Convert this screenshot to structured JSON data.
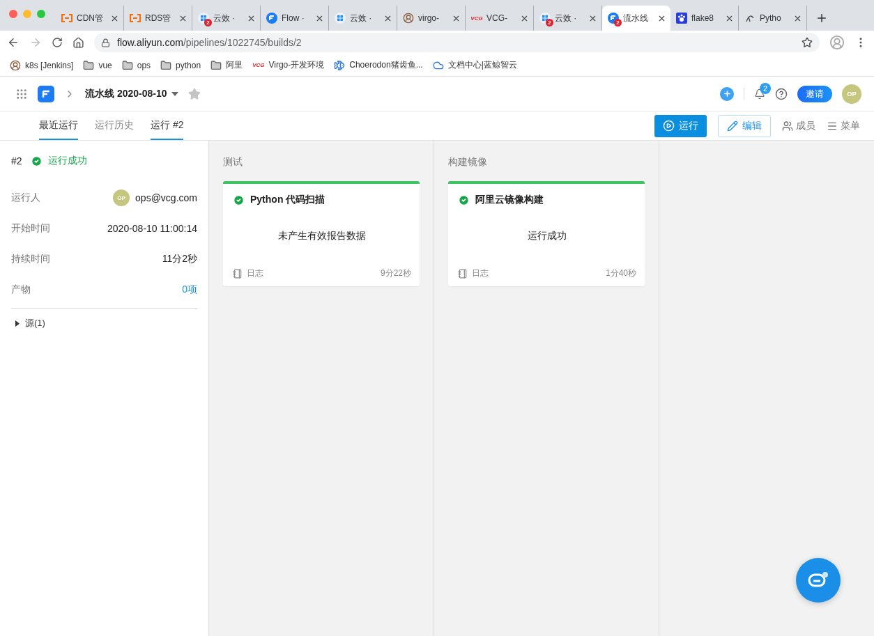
{
  "browser": {
    "tabs": [
      {
        "title": "CDN管",
        "kind": "bracket",
        "selected": false
      },
      {
        "title": "RDS管",
        "kind": "bracket",
        "selected": false
      },
      {
        "title": "云效 ·",
        "kind": "grid",
        "badge": "2",
        "selected": false
      },
      {
        "title": "Flow ·",
        "kind": "flow",
        "selected": false
      },
      {
        "title": "云效 ·",
        "kind": "grid",
        "selected": false
      },
      {
        "title": "virgo-",
        "kind": "person",
        "selected": false
      },
      {
        "title": "VCG-",
        "kind": "wordmark",
        "logo_text": "VCG",
        "selected": false
      },
      {
        "title": "云效 ·",
        "kind": "grid",
        "badge": "2",
        "selected": false
      },
      {
        "title": "流水线",
        "kind": "flow",
        "badge": "2",
        "selected": true
      },
      {
        "title": "flake8",
        "kind": "paw",
        "selected": false
      },
      {
        "title": "Pytho",
        "kind": "sketch",
        "selected": false
      }
    ],
    "address": {
      "host": "flow.aliyun.com",
      "path": "/pipelines/1022745/builds/2"
    },
    "bookmarks": [
      {
        "label": "k8s [Jenkins]",
        "kind": "person"
      },
      {
        "label": "vue",
        "kind": "folder"
      },
      {
        "label": "ops",
        "kind": "folder"
      },
      {
        "label": "python",
        "kind": "folder"
      },
      {
        "label": "阿里",
        "kind": "folder"
      },
      {
        "label": "Virgo-开发环境",
        "kind": "wordmark",
        "logo_text": "VCG"
      },
      {
        "label": "Choerodon猪齿鱼...",
        "kind": "fish"
      },
      {
        "label": "文档中心|蓝鲸智云",
        "kind": "cloud"
      }
    ]
  },
  "header": {
    "title": "流水线 2020-08-10",
    "starred": false,
    "notification_count": "2",
    "invite_button": "邀请",
    "avatar": "OP"
  },
  "nav": {
    "tabs": [
      {
        "label": "最近运行",
        "selected": true
      },
      {
        "label": "运行历史",
        "selected": false
      },
      {
        "label": "运行 #2",
        "selected": true
      }
    ],
    "run_button": "运行",
    "edit_button": "编辑",
    "members": "成员",
    "menu": "菜单"
  },
  "summary": {
    "number": "#2",
    "passed": true,
    "status_label": "运行成功",
    "fields": [
      {
        "label": "运行人",
        "value": "ops@vcg.com",
        "avatar": "OP",
        "kind": "user"
      },
      {
        "label": "开始时间",
        "value": "2020-08-10 11:00:14",
        "kind": "text"
      },
      {
        "label": "持续时间",
        "value": "11分2秒",
        "kind": "text"
      },
      {
        "label": "产物",
        "value": "0项",
        "kind": "link"
      }
    ],
    "sources": {
      "label": "源(1)",
      "expanded": false
    }
  },
  "stages": [
    {
      "name": "测试",
      "jobs": [
        {
          "title": "Python 代码扫描",
          "passed": true,
          "message": "未产生有效报告数据",
          "log_label": "日志",
          "duration": "9分22秒"
        }
      ]
    },
    {
      "name": "构建镜像",
      "jobs": [
        {
          "title": "阿里云镜像构建",
          "passed": true,
          "message": "运行成功",
          "log_label": "日志",
          "duration": "1分40秒"
        }
      ]
    }
  ]
}
